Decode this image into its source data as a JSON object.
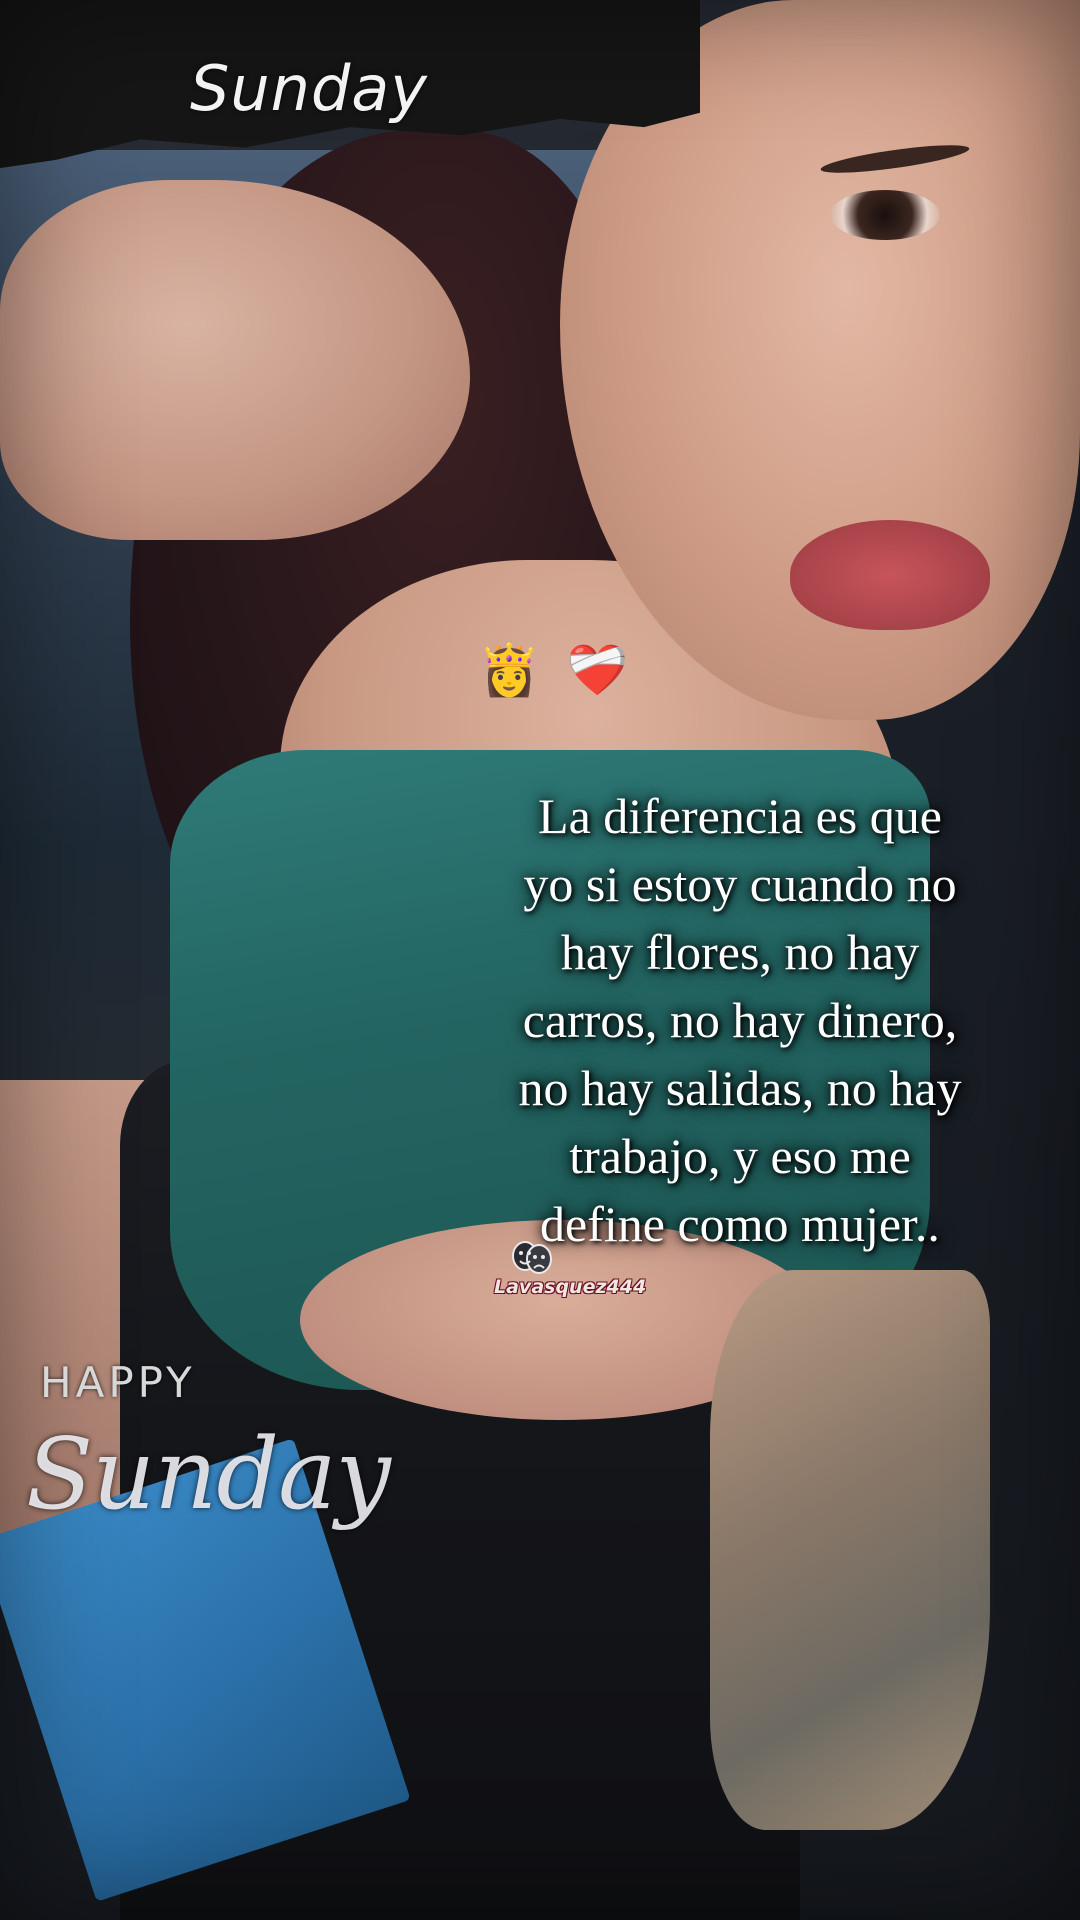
{
  "overlay": {
    "top_title": "Sunday",
    "emojis": [
      {
        "icon": "princess-emoji",
        "glyph": "👸"
      },
      {
        "icon": "bandaged-heart-emoji",
        "glyph": "❤️‍🩹"
      }
    ],
    "quote_lines": [
      "La diferencia es que",
      "yo si estoy cuando no",
      "hay flores, no hay",
      "carros, no hay dinero,",
      "no hay salidas, no hay",
      "trabajo, y eso me",
      "define como mujer.."
    ],
    "watermark": "Lavasquez444",
    "bottom_small": "HAPPY",
    "bottom_large": "Sunday"
  },
  "colors": {
    "text": "#ffffff",
    "watermark_outline": "#6b1020",
    "top_fabric": "#2f7b79",
    "accent_blue": "#3a8bc8"
  }
}
